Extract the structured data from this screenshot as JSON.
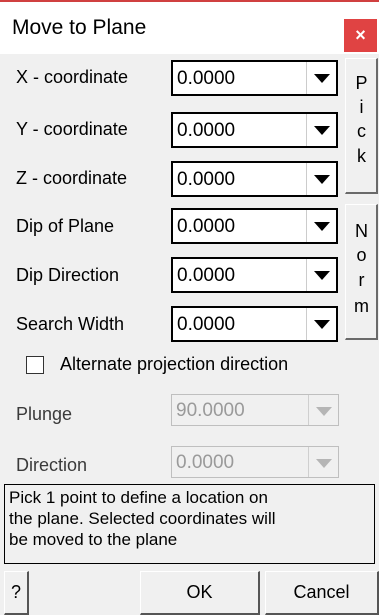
{
  "window": {
    "title": "Move to Plane",
    "close_glyph": "×"
  },
  "fields": [
    {
      "label": "X - coordinate",
      "value": "0.0000",
      "enabled": true
    },
    {
      "label": "Y - coordinate",
      "value": "0.0000",
      "enabled": true
    },
    {
      "label": "Z - coordinate",
      "value": "0.0000",
      "enabled": true
    },
    {
      "label": "Dip of Plane",
      "value": "0.0000",
      "enabled": true
    },
    {
      "label": "Dip Direction",
      "value": "0.0000",
      "enabled": true
    },
    {
      "label": "Search Width",
      "value": "0.0000",
      "enabled": true
    },
    {
      "label": "Plunge",
      "value": "90.0000",
      "enabled": false
    },
    {
      "label": "Direction",
      "value": "0.0000",
      "enabled": false
    }
  ],
  "side_buttons": {
    "pick": [
      "P",
      "i",
      "c",
      "k"
    ],
    "norm": [
      "N",
      "o",
      "r",
      "m"
    ]
  },
  "checkbox": {
    "label": "Alternate projection direction",
    "checked": false
  },
  "info_lines": [
    "Pick 1 point to define a location on",
    "the plane. Selected coordinates will",
    "be moved to the plane"
  ],
  "buttons": {
    "help": "?",
    "ok": "OK",
    "cancel": "Cancel"
  },
  "colors": {
    "close_button": "#e04343",
    "dialog_bg": "#f0f0f0"
  }
}
